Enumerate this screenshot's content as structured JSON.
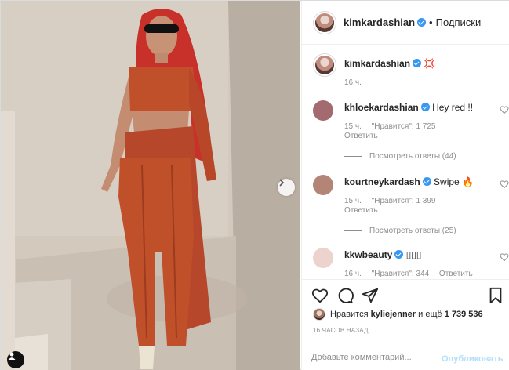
{
  "post": {
    "author": "kimkardashian",
    "follow_label": "Подписки",
    "separator": "•",
    "icons": {
      "next": "chevron-right-icon",
      "tags": "user-tag-icon",
      "like": "heart-icon",
      "comment": "comment-bubble-icon",
      "share": "paper-plane-icon",
      "save": "bookmark-icon"
    }
  },
  "caption": {
    "username": "kimkardashian",
    "text": "💢",
    "time": "16 ч."
  },
  "comments": [
    {
      "username": "khloekardashian",
      "text": "Hey red !!",
      "time": "15 ч.",
      "likes": "\"Нравится\": 1 725",
      "reply_label": "Ответить",
      "view_replies": "Посмотреть ответы (44)",
      "avatar_color": "#a36b6f"
    },
    {
      "username": "kourtneykardash",
      "text": "Swipe 🔥",
      "time": "15 ч.",
      "likes": "\"Нравится\": 1 399",
      "reply_label": "Ответить",
      "view_replies": "Посмотреть ответы (25)",
      "avatar_color": "#b28576"
    },
    {
      "username": "kkwbeauty",
      "text": "▯▯▯",
      "time": "16 ч.",
      "likes": "\"Нравится\": 344",
      "reply_label": "Ответить",
      "avatar_color": "#ecd3cd"
    }
  ],
  "likes_line": {
    "prefix": "Нравится",
    "user": "kyliejenner",
    "middle": "и ещё",
    "count": "1 739 536"
  },
  "timestamp": "16 ЧАСОВ НАЗАД",
  "add_comment": {
    "placeholder": "Добавьте комментарий...",
    "post_label": "Опубликовать"
  },
  "colors": {
    "accent_link": "#b2dffc",
    "verified": "#3897f0",
    "outfit": "#c0502a",
    "hair": "#c8312a"
  }
}
